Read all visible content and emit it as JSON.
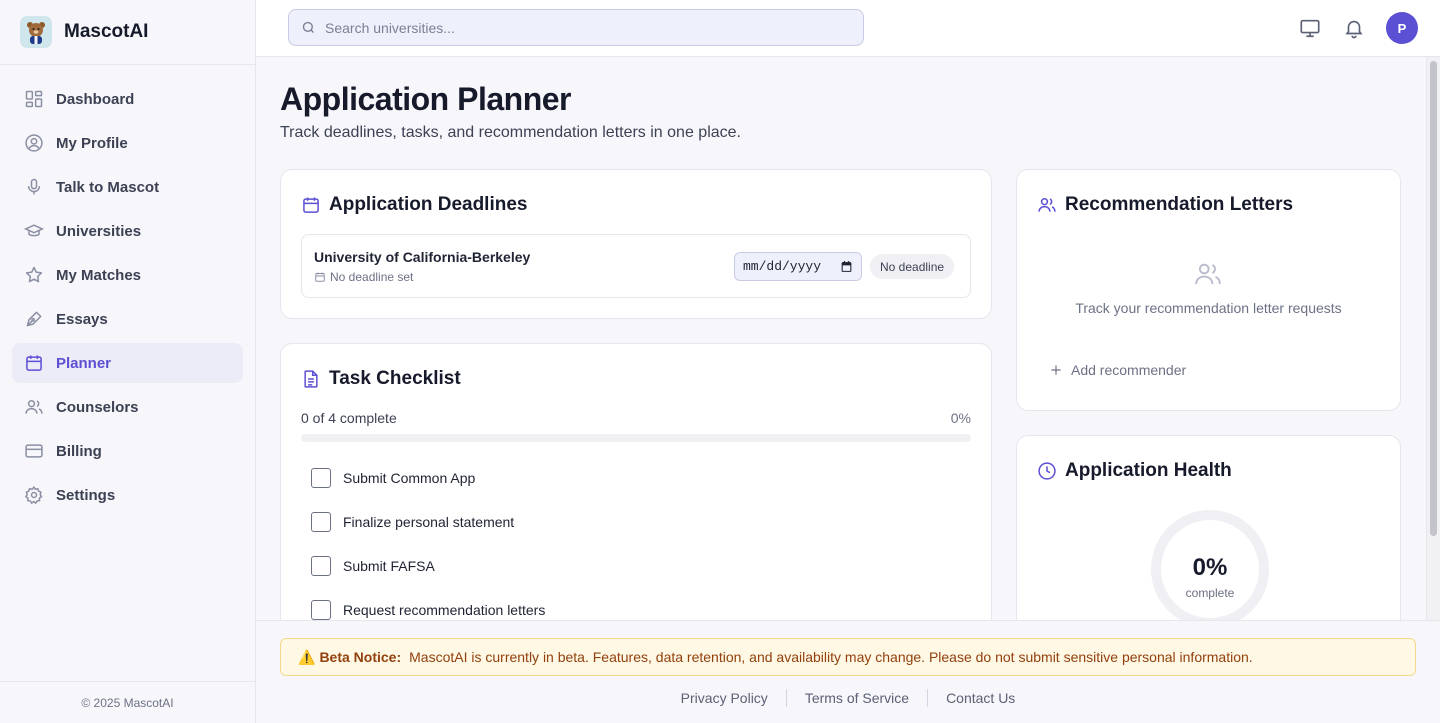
{
  "brand": {
    "name": "MascotAI"
  },
  "sidebar": {
    "items": [
      {
        "label": "Dashboard",
        "icon": "grid-icon"
      },
      {
        "label": "My Profile",
        "icon": "user-circle-icon"
      },
      {
        "label": "Talk to Mascot",
        "icon": "microphone-icon"
      },
      {
        "label": "Universities",
        "icon": "graduation-cap-icon"
      },
      {
        "label": "My Matches",
        "icon": "star-icon"
      },
      {
        "label": "Essays",
        "icon": "pen-icon"
      },
      {
        "label": "Planner",
        "icon": "calendar-icon",
        "active": true
      },
      {
        "label": "Counselors",
        "icon": "users-icon"
      },
      {
        "label": "Billing",
        "icon": "credit-card-icon"
      },
      {
        "label": "Settings",
        "icon": "gear-icon"
      }
    ],
    "footer": "© 2025 MascotAI"
  },
  "topbar": {
    "search_placeholder": "Search universities...",
    "avatar_initial": "P"
  },
  "page": {
    "title": "Application Planner",
    "subtitle": "Track deadlines, tasks, and recommendation letters in one place."
  },
  "deadlines": {
    "title": "Application Deadlines",
    "items": [
      {
        "university": "University of California-Berkeley",
        "sub": "No deadline set",
        "date_placeholder": "mm/dd/yyyy",
        "badge": "No deadline"
      }
    ]
  },
  "tasks": {
    "title": "Task Checklist",
    "progress_label": "0 of 4 complete",
    "progress_pct": "0%",
    "progress_value": 0,
    "items": [
      {
        "label": "Submit Common App",
        "checked": false
      },
      {
        "label": "Finalize personal statement",
        "checked": false
      },
      {
        "label": "Submit FAFSA",
        "checked": false
      },
      {
        "label": "Request recommendation letters",
        "checked": false
      }
    ]
  },
  "recommendations": {
    "title": "Recommendation Letters",
    "empty_text": "Track your recommendation letter requests",
    "add_label": "Add recommender"
  },
  "health": {
    "title": "Application Health",
    "pct": "0%",
    "label": "complete",
    "value": 0
  },
  "footer": {
    "beta_title": "Beta Notice:",
    "beta_text": "MascotAI is currently in beta. Features, data retention, and availability may change. Please do not submit sensitive personal information.",
    "links": [
      "Privacy Policy",
      "Terms of Service",
      "Contact Us"
    ]
  },
  "colors": {
    "accent": "#5b4fd3",
    "warning_bg": "#fff8e4",
    "warning_text": "#92400e"
  }
}
